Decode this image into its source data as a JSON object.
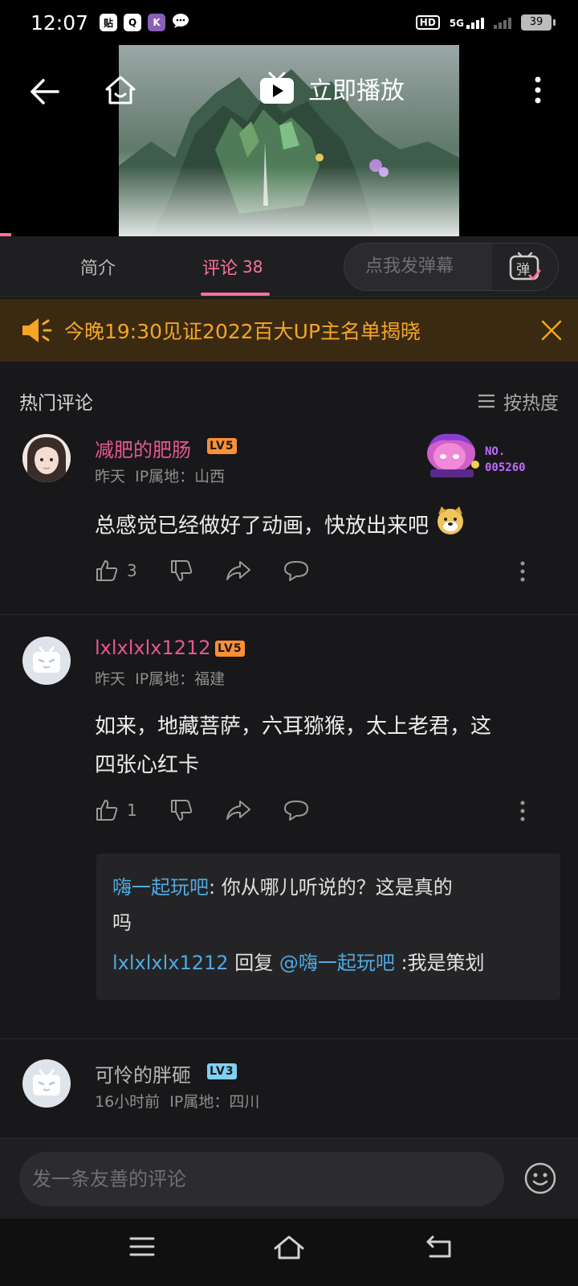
{
  "status_bar": {
    "time": "12:07",
    "app_icons": [
      "贴",
      "Q",
      "K"
    ],
    "hd": "HD",
    "network": "5G",
    "battery": "39"
  },
  "player": {
    "play_now_label": "立即播放"
  },
  "tabs": {
    "intro": "简介",
    "comments_label": "评论",
    "comments_count": "38",
    "danmaku_placeholder": "点我发弹幕",
    "danmaku_button": "弹"
  },
  "notice": {
    "text": "今晚19:30见证2022百大UP主名单揭晓"
  },
  "hot_comments": {
    "title": "热门评论",
    "sort_label": "按热度"
  },
  "comments": [
    {
      "user": "减肥的肥肠",
      "level": "LV5",
      "time": "昨天",
      "ip": "IP属地：山西",
      "text": "总感觉已经做好了动画，快放出来吧",
      "likes": "3",
      "badge_no": "NO.",
      "badge_num": "005260"
    },
    {
      "user": "lxlxlxlx1212",
      "level": "LV5",
      "time": "昨天",
      "ip": "IP属地：福建",
      "text_line1": "如来，地藏菩萨，六耳猕猴，太上老君，这",
      "text_line2": "四张心红卡",
      "likes": "1",
      "replies": {
        "r1_user": "嗨一起玩吧",
        "r1_text_a": ": 你从哪儿听说的？这是真的",
        "r1_text_b": "吗",
        "r2_user": "lxlxlxlx1212",
        "r2_reply": " 回复 ",
        "r2_mention": "@嗨一起玩吧",
        "r2_text": " :我是策划"
      }
    },
    {
      "user": "可怜的胖砸",
      "level": "LV3",
      "time": "16小时前",
      "ip": "IP属地：四川"
    }
  ],
  "input_bar": {
    "placeholder": "发一条友善的评论"
  },
  "colors": {
    "accent_pink": "#fb7299",
    "username_pink": "#e7588a",
    "notice_orange": "#f5a623",
    "reply_blue": "#4fa9e0"
  }
}
